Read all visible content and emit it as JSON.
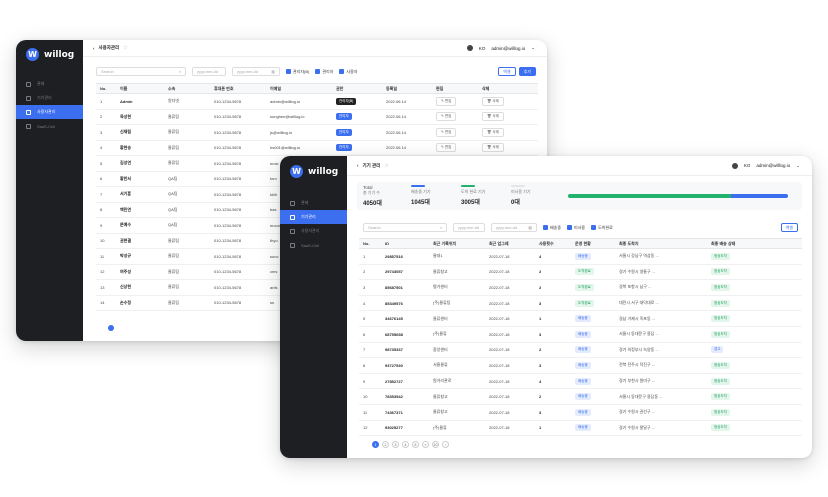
{
  "brand": {
    "logo_text": "willog",
    "logo_mark": "W"
  },
  "user": {
    "lang": "KO",
    "email": "admin@willlog.io"
  },
  "colors": {
    "accent": "#3b6ff0",
    "sidebar": "#1e1f22",
    "green": "#23b26d"
  },
  "back_window": {
    "title": "사용자관리",
    "nav": [
      "관제",
      "기기관리",
      "사용자관리",
      "SaaS-Cell"
    ],
    "filter": {
      "search_placeholder": "Search",
      "date_from": "yyyy.mm.dd",
      "date_to": "yyyy.mm.dd",
      "checks": [
        "관리자(B)",
        "관리자",
        "사용자"
      ],
      "excel": "엑셀",
      "add": "추가"
    },
    "columns": [
      "No.",
      "이름",
      "소속",
      "휴대폰 번호",
      "이메일",
      "권한",
      "등록일",
      "편집",
      "삭제"
    ],
    "rows": [
      {
        "no": "1",
        "name": "Admin",
        "org": "원더넷",
        "phone": "010-1234-5678",
        "email": "admin@willlog.io",
        "role": "관리자(B)",
        "date": "2022.06.14",
        "edit": "편집",
        "del": "삭제"
      },
      {
        "no": "2",
        "name": "육성현",
        "org": "물류팀",
        "phone": "010-1234-5678",
        "email": "sunghen@willlog.io",
        "role": "관리자",
        "date": "2022.06.14",
        "edit": "편집",
        "del": "삭제"
      },
      {
        "no": "3",
        "name": "신재림",
        "org": "물류팀",
        "phone": "010-1234-5678",
        "email": "js@willlog.io",
        "role": "관리자",
        "date": "2022.06.14",
        "edit": "편집",
        "del": "삭제"
      },
      {
        "no": "4",
        "name": "황현승",
        "org": "물류팀",
        "phone": "010-1234-5678",
        "email": "hs001@willlog.io",
        "role": "관리자",
        "date": "2022.06.14",
        "edit": "편집",
        "del": "삭제"
      },
      {
        "no": "5",
        "name": "김성연",
        "org": "물류팀",
        "phone": "010-1234-5678",
        "email": "mosi",
        "role": "",
        "date": "",
        "edit": "",
        "del": ""
      },
      {
        "no": "6",
        "name": "황한서",
        "org": "QA팀",
        "phone": "010-1234-5678",
        "email": "tom",
        "role": "",
        "date": "",
        "edit": "",
        "del": ""
      },
      {
        "no": "7",
        "name": "서기훈",
        "org": "QA팀",
        "phone": "010-1234-5678",
        "email": "kkih",
        "role": "",
        "date": "",
        "edit": "",
        "del": ""
      },
      {
        "no": "8",
        "name": "백민연",
        "org": "QA팀",
        "phone": "010-1234-5678",
        "email": "bas",
        "role": "",
        "date": "",
        "edit": "",
        "del": ""
      },
      {
        "no": "9",
        "name": "문예수",
        "org": "QA팀",
        "phone": "010-1234-5678",
        "email": "moon",
        "role": "",
        "date": "",
        "edit": "",
        "del": ""
      },
      {
        "no": "10",
        "name": "권현결",
        "org": "물류팀",
        "phone": "010-1234-5678",
        "email": "thyo",
        "role": "",
        "date": "",
        "edit": "",
        "del": ""
      },
      {
        "no": "11",
        "name": "박성규",
        "org": "물류팀",
        "phone": "010-1234-5678",
        "email": "sunc",
        "role": "",
        "date": "",
        "edit": "",
        "del": ""
      },
      {
        "no": "12",
        "name": "여주성",
        "org": "물류팀",
        "phone": "010-1234-5678",
        "email": "cms",
        "role": "",
        "date": "",
        "edit": "",
        "del": ""
      },
      {
        "no": "13",
        "name": "신상현",
        "org": "물류팀",
        "phone": "010-1234-5678",
        "email": "anfs",
        "role": "",
        "date": "",
        "edit": "",
        "del": ""
      },
      {
        "no": "14",
        "name": "손수정",
        "org": "물류팀",
        "phone": "010-1234-5678",
        "email": "ss",
        "role": "",
        "date": "",
        "edit": "",
        "del": ""
      }
    ]
  },
  "front_window": {
    "title": "기기 관리",
    "nav": [
      "관제",
      "기기관리",
      "사용자관리",
      "SaaS-Cell"
    ],
    "stats": [
      {
        "label": "Total",
        "sub": "총 기기 수",
        "value": "4050대",
        "color": "#cfd3da"
      },
      {
        "label": "",
        "sub": "배송중 기기",
        "value": "1045대",
        "color": "#3b6ff0"
      },
      {
        "label": "",
        "sub": "도착 완료 기기",
        "value": "3005대",
        "color": "#23b26d"
      },
      {
        "label": "",
        "sub": "미사용 기기",
        "value": "0대",
        "color": "#e3e5e9"
      }
    ],
    "progress": {
      "delivered_ratio": 0.742,
      "shipping_ratio": 0.258
    },
    "filter": {
      "search_placeholder": "Search",
      "date_from": "yyyy.mm.dd",
      "date_to": "yyyy.mm.dd",
      "checks": [
        "배송중",
        "미사용",
        "도착완료"
      ],
      "excel": "엑셀"
    },
    "columns": [
      "No.",
      "ID",
      "최근 기록위치",
      "최근 업그레",
      "사용횟수",
      "운영 현황",
      "최종 도착지",
      "최종 배송 상태"
    ],
    "rows": [
      {
        "no": "1",
        "id": "29857516",
        "loc": "물대1",
        "date": "2022-07-18",
        "count": "4",
        "status": "배송중",
        "st": "lb",
        "dest": "서울시 강남구 역삼동 ...",
        "final": "정상도착",
        "ft": "gr"
      },
      {
        "no": "2",
        "id": "29743057",
        "loc": "물류창고",
        "date": "2022-07-18",
        "count": "2",
        "status": "도착완료",
        "st": "gr",
        "dest": "경기 수원시 영통구 ...",
        "final": "정상도착",
        "ft": "gr"
      },
      {
        "no": "3",
        "id": "85687501",
        "loc": "평가센터",
        "date": "2022-07-18",
        "count": "2",
        "status": "도착완료",
        "st": "gr",
        "dest": "경북 포항시 남구 ...",
        "final": "정상도착",
        "ft": "gr"
      },
      {
        "no": "4",
        "id": "85349576",
        "loc": "(주)물류팀",
        "date": "2022-07-18",
        "count": "3",
        "status": "도착완료",
        "st": "gr",
        "dest": "대전시 서구 대덕대로 ...",
        "final": "정상도착",
        "ft": "gr"
      },
      {
        "no": "5",
        "id": "34676145",
        "loc": "물류센터",
        "date": "2022-07-18",
        "count": "1",
        "status": "배송중",
        "st": "lb",
        "dest": "경남 거제시 옥포동 ...",
        "final": "정상도착",
        "ft": "gr"
      },
      {
        "no": "6",
        "id": "68755658",
        "loc": "(주)물류",
        "date": "2022-07-18",
        "count": "3",
        "status": "배송중",
        "st": "lb",
        "dest": "서울시 동대문구 용답 ...",
        "final": "정상도착",
        "ft": "gr"
      },
      {
        "no": "7",
        "id": "98735337",
        "loc": "중앙센터",
        "date": "2022-07-18",
        "count": "2",
        "status": "배송중",
        "st": "lb",
        "dest": "경기 의정부시 녹양동 ...",
        "final": "경고",
        "ft": "lb"
      },
      {
        "no": "8",
        "id": "93727530",
        "loc": "서울물류",
        "date": "2022-07-18",
        "count": "3",
        "status": "배송중",
        "st": "lb",
        "dest": "전북 전주시 덕진구 ...",
        "final": "정상도착",
        "ft": "gr"
      },
      {
        "no": "9",
        "id": "27852727",
        "loc": "원거리관로",
        "date": "2022-07-18",
        "count": "4",
        "status": "배송중",
        "st": "lb",
        "dest": "경기 부천시 원미구 ...",
        "final": "정상도착",
        "ft": "gr"
      },
      {
        "no": "10",
        "id": "78353542",
        "loc": "물류창고",
        "date": "2022-07-18",
        "count": "2",
        "status": "배송중",
        "st": "lb",
        "dest": "서울시 동대문구 용답동 ...",
        "final": "정상도착",
        "ft": "gr"
      },
      {
        "no": "11",
        "id": "74367371",
        "loc": "물류창고",
        "date": "2022-07-18",
        "count": "3",
        "status": "배송중",
        "st": "lb",
        "dest": "경기 수원시 권선구 ...",
        "final": "정상도착",
        "ft": "gr"
      },
      {
        "no": "12",
        "id": "93025277",
        "loc": "(주)물류",
        "date": "2022-07-18",
        "count": "1",
        "status": "배송중",
        "st": "lb",
        "dest": "경기 수원시 팔달구 ...",
        "final": "정상도착",
        "ft": "gr"
      }
    ],
    "pages": [
      "1",
      "2",
      "3",
      "4",
      "5",
      "»",
      "10",
      "›"
    ]
  }
}
